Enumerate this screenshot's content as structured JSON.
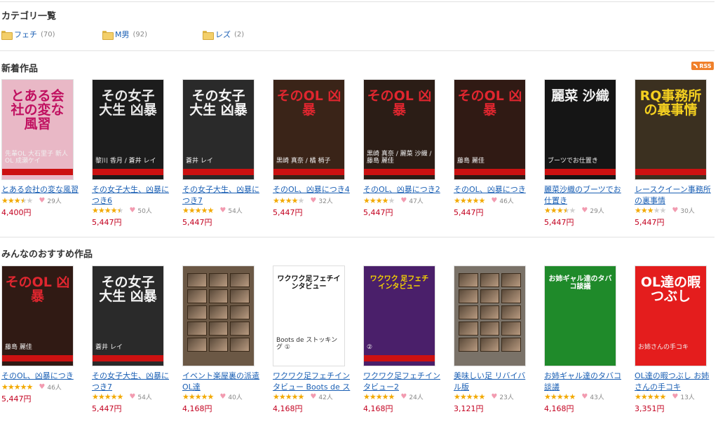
{
  "categories": {
    "title": "カテゴリ一覧",
    "items": [
      {
        "label": "フェチ",
        "count": "(70)"
      },
      {
        "label": "M男",
        "count": "(92)"
      },
      {
        "label": "レズ",
        "count": "(2)"
      }
    ]
  },
  "new_section": {
    "title": "新着作品",
    "rss_label": "RSS",
    "items": [
      {
        "name": "とある会社の変な風習",
        "rating": 3.5,
        "likes": "29人",
        "price": "4,400円",
        "cover": {
          "bg": "#e9b8c6",
          "title": "とある会社の変な風習",
          "title_color": "#c01060",
          "sub": "先輩OL 大石里子  新人OL 成瀬ケイ"
        }
      },
      {
        "name": "その女子大生、凶暴につき6",
        "rating": 4.5,
        "likes": "50人",
        "price": "5,447円",
        "cover": {
          "bg": "#1c1c1c",
          "title": "その女子大生 凶暴",
          "title_color": "#e8e8e8",
          "sub": "黎川 香月 / 蒼井 レイ"
        }
      },
      {
        "name": "その女子大生、凶暴につき7",
        "rating": 5,
        "likes": "54人",
        "price": "5,447円",
        "cover": {
          "bg": "#2a2a2a",
          "title": "その女子大生 凶暴",
          "title_color": "#f4f4f4",
          "sub": "蒼井 レイ"
        }
      },
      {
        "name": "そのOL、凶暴につき4",
        "rating": 4,
        "likes": "32人",
        "price": "5,447円",
        "cover": {
          "bg": "#3a2418",
          "title": "そのOL 凶暴",
          "title_color": "#e0262f",
          "sub": "黒崎 真奈 / 橘 梢子"
        }
      },
      {
        "name": "そのOL、凶暴につき2",
        "rating": 4,
        "likes": "47人",
        "price": "5,447円",
        "cover": {
          "bg": "#2b1d16",
          "title": "そのOL 凶暴",
          "title_color": "#e0262f",
          "sub": "黒崎 真奈 / 麗菜 沙織 / 藤島 麗佳"
        }
      },
      {
        "name": "そのOL、凶暴につき",
        "rating": 5,
        "likes": "46人",
        "price": "5,447円",
        "cover": {
          "bg": "#301a14",
          "title": "そのOL 凶暴",
          "title_color": "#e0262f",
          "sub": "藤島 麗佳"
        }
      },
      {
        "name": "麗菜沙織のブーツでお仕置き",
        "rating": 3.5,
        "likes": "29人",
        "price": "5,447円",
        "cover": {
          "bg": "#151515",
          "title": "麗菜 沙織",
          "title_color": "#f2f2f2",
          "sub": "ブーツでお仕置き"
        }
      },
      {
        "name": "レースクイーン事務所の裏事情",
        "rating": 3,
        "likes": "30人",
        "price": "5,447円",
        "cover": {
          "bg": "#3b3020",
          "title": "RQ事務所の裏事情",
          "title_color": "#f4d020",
          "sub": ""
        }
      }
    ]
  },
  "recommend_section": {
    "title": "みんなのおすすめ作品",
    "items": [
      {
        "name": "そのOL、凶暴につき",
        "rating": 5,
        "likes": "46人",
        "price": "5,447円",
        "cover": {
          "bg": "#301a14",
          "title": "そのOL 凶暴",
          "title_color": "#e0262f",
          "sub": "藤島 麗佳"
        }
      },
      {
        "name": "その女子大生、凶暴につき7",
        "rating": 5,
        "likes": "54人",
        "price": "5,447円",
        "cover": {
          "bg": "#2a2a2a",
          "title": "その女子大生 凶暴",
          "title_color": "#f4f4f4",
          "sub": "蒼井 レイ"
        }
      },
      {
        "name": "イベント楽屋裏の派遣OL達",
        "rating": 5,
        "likes": "40人",
        "price": "4,168円",
        "cover": {
          "bg": "#6b5845",
          "title": "",
          "title_color": "#ffffff",
          "sub": ""
        }
      },
      {
        "name": "ワクワク足フェチインタビュー Boots de ストッキング",
        "rating": 5,
        "likes": "42人",
        "price": "4,168円",
        "cover": {
          "bg": "#ffffff",
          "title": "ワクワク足フェチインタビュー",
          "title_color": "#111111",
          "sub": "Boots de ストッキング ①"
        }
      },
      {
        "name": "ワクワク足フェチインタビュー2",
        "rating": 5,
        "likes": "24人",
        "price": "4,168円",
        "cover": {
          "bg": "#4a1f6a",
          "title": "ワクワク 足フェチ インタビュー",
          "title_color": "#f5d400",
          "sub": "②"
        }
      },
      {
        "name": "美味しい足 リバイバル版",
        "rating": 5,
        "likes": "23人",
        "price": "3,121円",
        "cover": {
          "bg": "#7a7268",
          "title": "",
          "title_color": "#ffffff",
          "sub": ""
        }
      },
      {
        "name": "お姉ギャル達のタバコ談議",
        "rating": 5,
        "likes": "43人",
        "price": "4,168円",
        "cover": {
          "bg": "#1f8a2a",
          "title": "お姉ギャル達のタバコ談議",
          "title_color": "#ffffff",
          "sub": ""
        }
      },
      {
        "name": "OL達の暇つぶし お姉さんの手コキ",
        "rating": 5,
        "likes": "13人",
        "price": "3,351円",
        "cover": {
          "bg": "#e41d1d",
          "title": "OL達の暇つぶし",
          "title_color": "#ffffff",
          "sub": "お姉さんの手コキ"
        }
      }
    ]
  }
}
